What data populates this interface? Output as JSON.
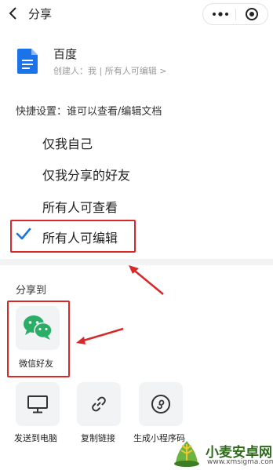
{
  "header": {
    "title": "分享"
  },
  "doc": {
    "name": "百度",
    "meta": "创建人：我 | 所有人可编辑 >"
  },
  "quick_settings": {
    "label": "快捷设置：谁可以查看/编辑文档",
    "options": [
      "仅我自己",
      "仅我分享的好友",
      "所有人可查看",
      "所有人可编辑"
    ],
    "selected_index": 3
  },
  "share": {
    "label": "分享到",
    "wechat_label": "微信好友",
    "targets": [
      "发送到电脑",
      "复制链接",
      "生成小程序码"
    ]
  },
  "watermark": {
    "name": "小麦安卓网",
    "url": "www.xmsigma.com"
  },
  "colors": {
    "accent": "#1a73e8",
    "highlight": "#d92828",
    "wechat": "#2aae67"
  }
}
